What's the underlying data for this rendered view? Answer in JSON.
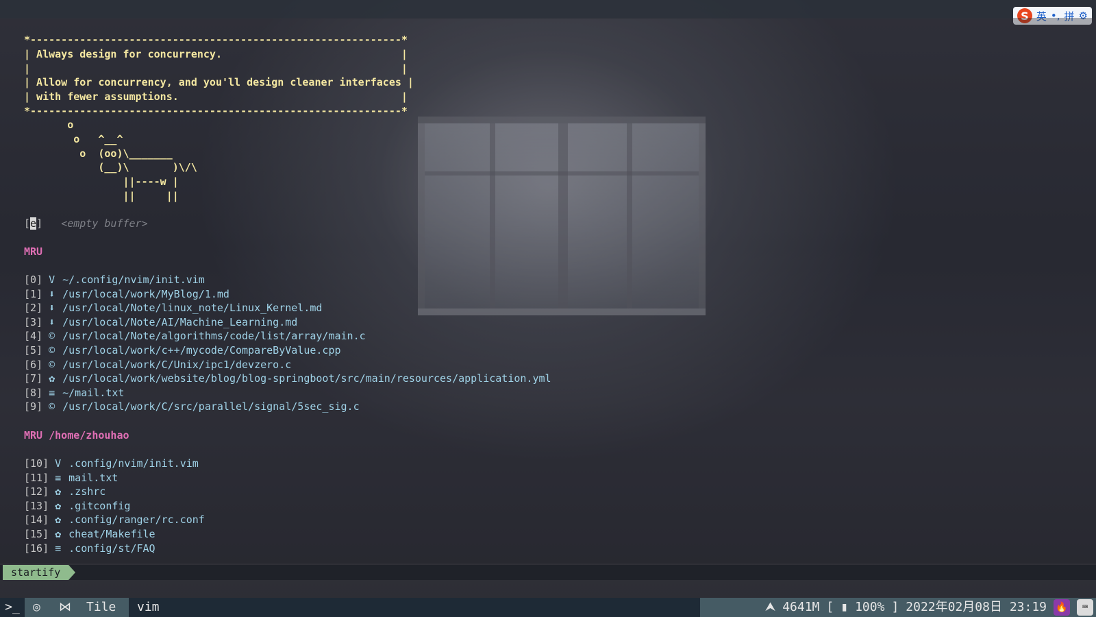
{
  "ime": {
    "logo": "S",
    "lang": "英",
    "punct": "•,",
    "mode": "拼",
    "settings_icon": "gear-icon"
  },
  "cowsay": {
    "border_top": "*------------------------------------------------------------*",
    "lines": [
      "| Always design for concurrency.                             |",
      "|                                                            |",
      "| Allow for concurrency, and you'll design cleaner interfaces |",
      "| with fewer assumptions.                                    |"
    ],
    "border_bottom": "*------------------------------------------------------------*",
    "art": [
      "       o",
      "        o   ^__^",
      "         o  (oo)\\_______",
      "            (__)\\       )\\/\\",
      "                ||----w |",
      "                ||     ||"
    ]
  },
  "empty_buffer": {
    "bracket_open": "[",
    "key": "e",
    "bracket_close": "]",
    "label": "<empty buffer>"
  },
  "mru": {
    "title": "MRU",
    "items": [
      {
        "index": "[0]",
        "icon": "vim-icon",
        "glyph": "V",
        "path": "~/.config/nvim/init.vim"
      },
      {
        "index": "[1]",
        "icon": "markdown-icon",
        "glyph": "⬇",
        "path": "/usr/local/work/MyBlog/1.md"
      },
      {
        "index": "[2]",
        "icon": "markdown-icon",
        "glyph": "⬇",
        "path": "/usr/local/Note/linux_note/Linux_Kernel.md"
      },
      {
        "index": "[3]",
        "icon": "markdown-icon",
        "glyph": "⬇",
        "path": "/usr/local/Note/AI/Machine_Learning.md"
      },
      {
        "index": "[4]",
        "icon": "c-file-icon",
        "glyph": "©",
        "path": "/usr/local/Note/algorithms/code/list/array/main.c"
      },
      {
        "index": "[5]",
        "icon": "cpp-file-icon",
        "glyph": "©",
        "path": "/usr/local/work/c++/mycode/CompareByValue.cpp"
      },
      {
        "index": "[6]",
        "icon": "c-file-icon",
        "glyph": "©",
        "path": "/usr/local/work/C/Unix/ipc1/devzero.c"
      },
      {
        "index": "[7]",
        "icon": "config-gear-icon",
        "glyph": "✿",
        "path": "/usr/local/work/website/blog/blog-springboot/src/main/resources/application.yml"
      },
      {
        "index": "[8]",
        "icon": "text-file-icon",
        "glyph": "≡",
        "path": "~/mail.txt"
      },
      {
        "index": "[9]",
        "icon": "c-file-icon",
        "glyph": "©",
        "path": "/usr/local/work/C/src/parallel/signal/5sec_sig.c"
      }
    ]
  },
  "mru_dir": {
    "title": "MRU /home/zhouhao",
    "items": [
      {
        "index": "[10]",
        "icon": "vim-icon",
        "glyph": "V",
        "path": ".config/nvim/init.vim"
      },
      {
        "index": "[11]",
        "icon": "text-file-icon",
        "glyph": "≡",
        "path": "mail.txt"
      },
      {
        "index": "[12]",
        "icon": "config-gear-icon",
        "glyph": "✿",
        "path": ".zshrc"
      },
      {
        "index": "[13]",
        "icon": "config-gear-icon",
        "glyph": "✿",
        "path": ".gitconfig"
      },
      {
        "index": "[14]",
        "icon": "config-gear-icon",
        "glyph": "✿",
        "path": ".config/ranger/rc.conf"
      },
      {
        "index": "[15]",
        "icon": "config-gear-icon",
        "glyph": "✿",
        "path": "cheat/Makefile"
      },
      {
        "index": "[16]",
        "icon": "text-file-icon",
        "glyph": "≡",
        "path": ".config/st/FAQ"
      }
    ]
  },
  "statusline": {
    "mode": "startify"
  },
  "taskbar": {
    "terminal_icon": ">_",
    "chrome_icon": "◎",
    "layout_icon": "⋈",
    "layout": "Tile",
    "window": "vim",
    "arch_icon": "⮝",
    "memory": "4641M",
    "battery_open": "[",
    "battery_icon": "▮",
    "battery": "100%",
    "battery_close": "]",
    "datetime": "2022年02月08日 23:19"
  },
  "colors": {
    "cow_text": "#f4e7a1",
    "section": "#e06fb5",
    "path": "#9fd2e7",
    "mode_bg": "#8fbb8d",
    "taskbar_bg": "#486068"
  }
}
